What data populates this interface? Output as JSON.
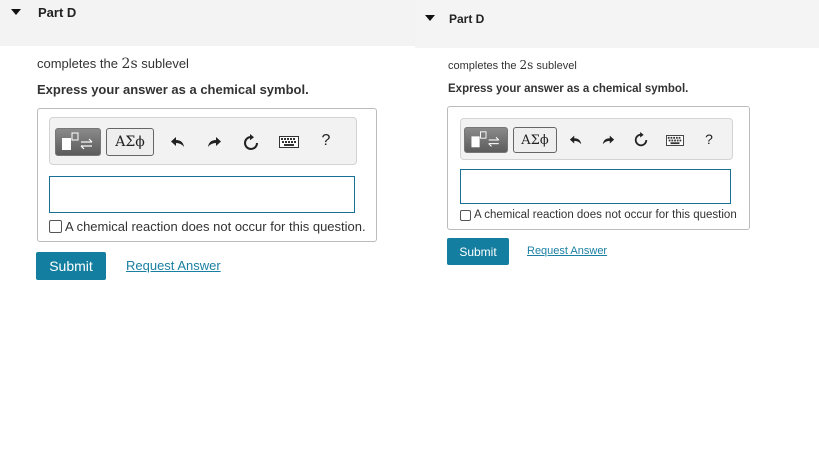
{
  "left": {
    "part_title": "Part D",
    "prompt_before": "completes the ",
    "prompt_symbol": "2s",
    "prompt_after": " sublevel",
    "instruction": "Express your answer as a chemical symbol.",
    "greek_label": "ΑΣϕ",
    "help_label": "?",
    "input_value": "",
    "no_reaction_label": "A chemical reaction does not occur for this question.",
    "submit_label": "Submit",
    "request_label": "Request Answer"
  },
  "right": {
    "part_title": "Part D",
    "prompt_before": "completes the ",
    "prompt_symbol": "2s",
    "prompt_after": " sublevel",
    "instruction": "Express your answer as a chemical symbol.",
    "greek_label": "ΑΣϕ",
    "help_label": "?",
    "input_value": "",
    "no_reaction_label": "A chemical reaction does not occur for this question",
    "submit_label": "Submit",
    "request_label": "Request Answer"
  },
  "icons": [
    "caret-down-icon",
    "templates-icon",
    "undo-icon",
    "redo-icon",
    "reset-icon",
    "keyboard-icon"
  ],
  "colors": {
    "accent": "#137ea0",
    "link": "#1a7fa3",
    "header_bg": "#f3f3f3",
    "input_border": "#1a6f94"
  }
}
